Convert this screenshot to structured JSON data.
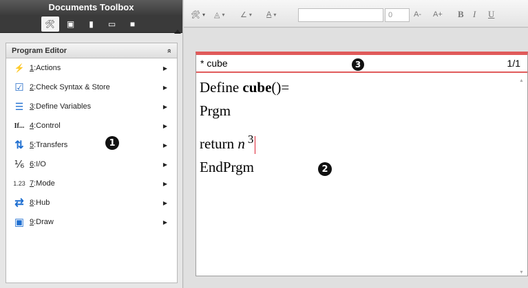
{
  "toolbox": {
    "title": "Documents Toolbox",
    "tab_icons": [
      "tools-icon",
      "pages-icon",
      "variables-icon",
      "library-icon",
      "folder-icon"
    ],
    "panel_title": "Program Editor",
    "collapse_glyph": "»",
    "items": [
      {
        "num": "1",
        "label": ":Actions",
        "icon": "lightning-icon",
        "glyph": "⚡"
      },
      {
        "num": "2",
        "label": ":Check Syntax & Store",
        "icon": "check-store-icon",
        "glyph": "☑"
      },
      {
        "num": "3",
        "label": ":Define Variables",
        "icon": "define-variables-icon",
        "glyph": "☰"
      },
      {
        "num": "4",
        "label": ":Control",
        "icon": "if-control-icon",
        "glyph": "If..."
      },
      {
        "num": "5",
        "label": ":Transfers",
        "icon": "transfer-arrows-icon",
        "glyph": "⇅"
      },
      {
        "num": "6",
        "label": ":I/O",
        "icon": "io-icon",
        "glyph": "½"
      },
      {
        "num": "7",
        "label": ":Mode",
        "icon": "mode-icon",
        "glyph": "1.23"
      },
      {
        "num": "8",
        "label": ":Hub",
        "icon": "hub-icon",
        "glyph": "⇄"
      },
      {
        "num": "9",
        "label": ":Draw",
        "icon": "draw-icon",
        "glyph": "▣"
      }
    ]
  },
  "toolbar": {
    "font_size": "0",
    "a_minus": "A-",
    "a_plus": "A+",
    "bold": "B",
    "italic": "I",
    "underline": "U"
  },
  "editor": {
    "title": "* cube",
    "page": "1/1",
    "lines": {
      "define_kw": "Define ",
      "define_name": "cube",
      "define_rest": "()=",
      "prgm": "Prgm",
      "return_kw": "return ",
      "return_var": "n",
      "return_exp": "3",
      "endprgm": "EndPrgm"
    }
  },
  "callouts": [
    "1",
    "2",
    "3"
  ],
  "colors": {
    "accent": "#e05a5a",
    "toolbox_dark": "#3a3a3a"
  }
}
